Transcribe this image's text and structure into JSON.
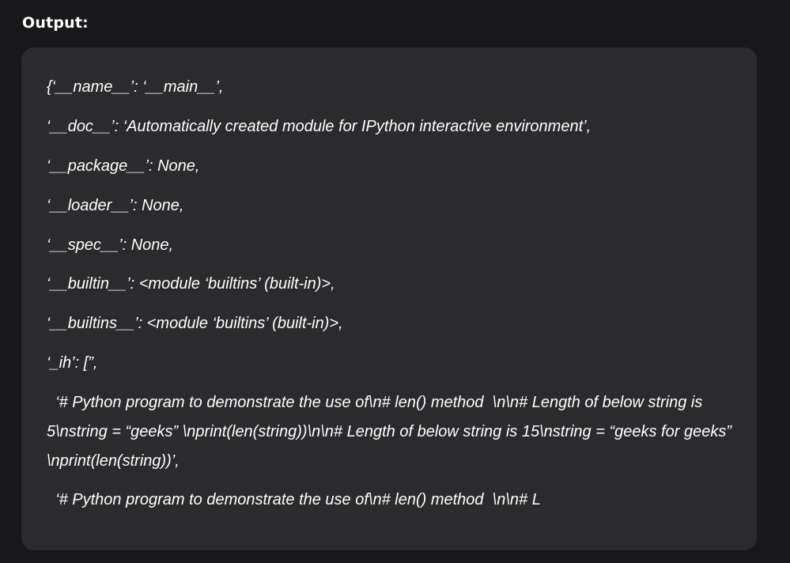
{
  "heading": "Output:",
  "output_lines": [
    "{‘__name__’: ‘__main__’,",
    "‘__doc__’: ‘Automatically created module for IPython interactive environment’,",
    "‘__package__’: None,",
    "‘__loader__’: None,",
    "‘__spec__’: None,",
    "‘__builtin__’: <module ‘builtins’ (built-in)>,",
    "‘__builtins__’: <module ‘builtins’ (built-in)>,",
    "‘_ih’: [”,"
  ],
  "output_para_1": "  ‘# Python program to demonstrate the use of\\n# len() method  \\n\\n# Length of below string is 5\\nstring = “geeks” \\nprint(len(string))\\n\\n# Length of below string is 15\\nstring = “geeks for geeks” \\nprint(len(string))’,",
  "output_para_2": "  ‘# Python program to demonstrate the use of\\n# len() method  \\n\\n# L"
}
